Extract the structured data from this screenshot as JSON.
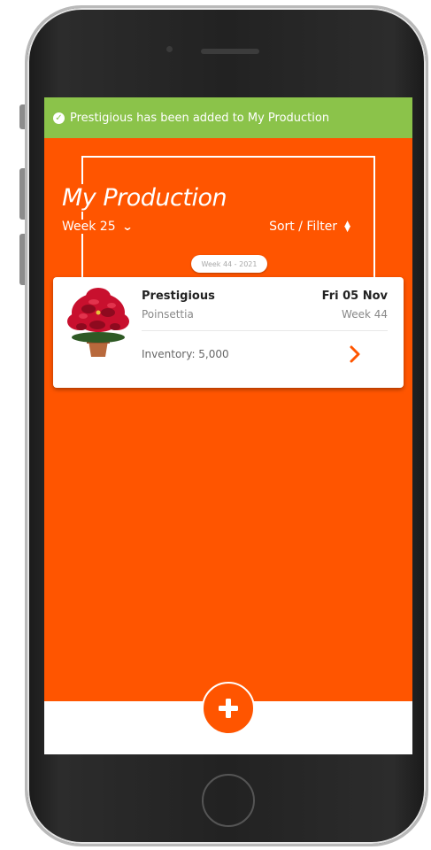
{
  "toast": {
    "message": "Prestigious has been added to My Production",
    "color": "#8bc34a"
  },
  "header": {
    "title": "My Production",
    "week_label": "Week 25",
    "sort_filter_label": "Sort / Filter",
    "week_pill": "Week 44 - 2021"
  },
  "card": {
    "name": "Prestigious",
    "species": "Poinsettia",
    "date": "Fri 05 Nov",
    "week": "Week 44",
    "inventory": "Inventory: 5,000"
  },
  "colors": {
    "accent": "#ff5500",
    "success": "#8bc34a"
  },
  "icons": [
    "check-circle-icon",
    "chevron-down-icon",
    "sort-icon",
    "chevron-right-icon",
    "plus-icon"
  ]
}
